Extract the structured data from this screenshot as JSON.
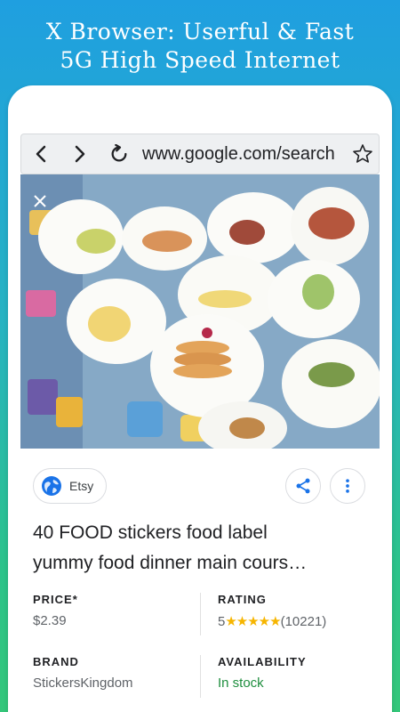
{
  "promo": {
    "line1": "X Browser: Userful & Fast",
    "line2": "5G High Speed Internet"
  },
  "browser": {
    "url": "www.google.com/search",
    "icons": [
      "back-icon",
      "forward-icon",
      "reload-icon",
      "bookmark-star-icon"
    ]
  },
  "result": {
    "source": "Etsy",
    "source_icon": "globe-icon",
    "title_line1": "40 FOOD stickers food label",
    "title_line2": "yummy food dinner main cours…",
    "price_label": "PRICE*",
    "price_value": "$2.39",
    "rating_label": "RATING",
    "rating_score": "5",
    "rating_stars": "★★★★★",
    "rating_count": "(10221)",
    "brand_label": "BRAND",
    "brand_value": "StickersKingdom",
    "availability_label": "AVAILABILITY",
    "availability_value": "In stock"
  },
  "colors": {
    "accent_blue": "#1a73e8",
    "star": "#f6b500",
    "in_stock": "#1e8e3e"
  }
}
